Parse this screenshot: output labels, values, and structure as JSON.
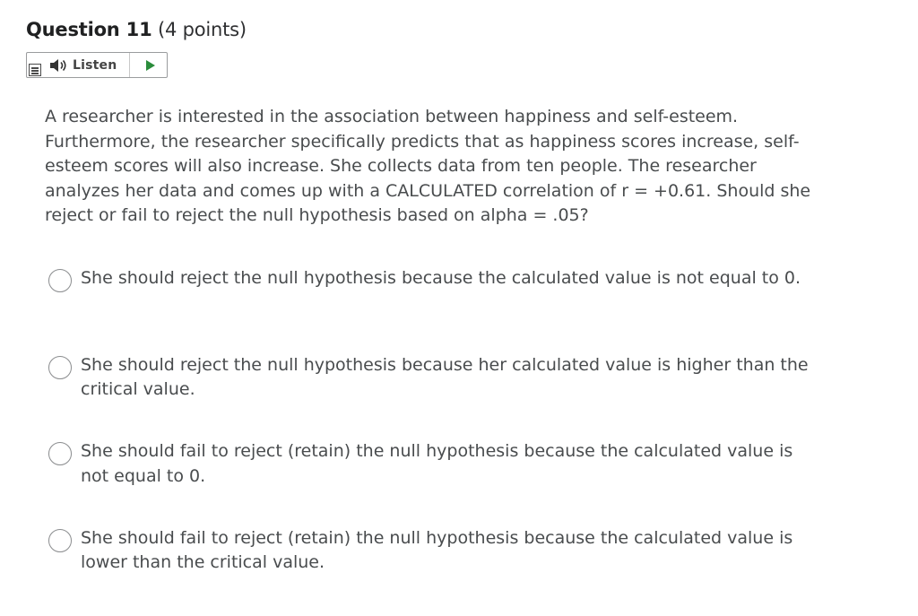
{
  "question": {
    "title": "Question 11",
    "points": "(4 points)"
  },
  "listen": {
    "label": "Listen"
  },
  "question_text": "A researcher is interested in the association between happiness and self-esteem. Furthermore, the researcher specifically predicts that as happiness scores increase, self-esteem scores will also increase. She collects data from ten people. The researcher analyzes her data and comes up with a CALCULATED correlation of r = +0.61. Should she reject or fail to reject the null hypothesis based on alpha = .05?",
  "options": [
    {
      "label": "She should reject the null hypothesis because the calculated value is not equal to 0."
    },
    {
      "label": "She should reject the null hypothesis because her calculated value is higher than the critical value."
    },
    {
      "label": "She should fail to reject (retain) the null hypothesis because the calculated value is not equal to 0."
    },
    {
      "label": "She should fail to reject (retain) the null hypothesis because the calculated value is lower than the critical value."
    }
  ],
  "icons": {
    "menu": "menu-icon",
    "speaker": "speaker-icon",
    "play": "play-icon"
  },
  "colors": {
    "text": "#494c4e",
    "title": "#202122",
    "play_accent": "#2a8c3b",
    "radio_border": "#8a8c8e"
  }
}
